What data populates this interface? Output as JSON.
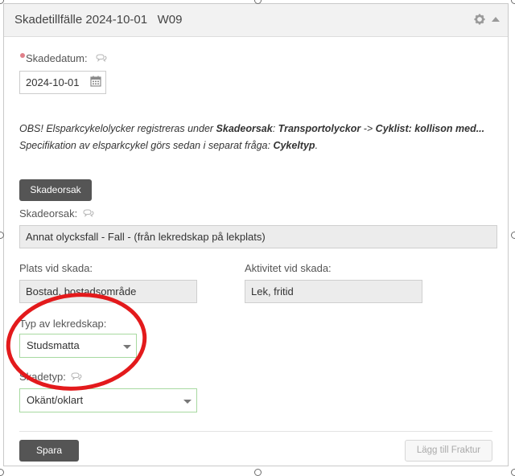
{
  "panel": {
    "title": "Skadetillfälle 2024-10-01   W09"
  },
  "form": {
    "skadedatum": {
      "label": "Skadedatum:",
      "value": "2024-10-01"
    },
    "notice": {
      "line1": {
        "pre": "OBS! Elsparkcykelolycker registreras under ",
        "b1": "Skadeorsak",
        "mid1": ": ",
        "b2": "Transportolyckor",
        "mid2": " -> ",
        "b3": "Cyklist: kollison med..."
      },
      "line2": {
        "pre": "Specifikation av elsparkcykel görs sedan i separat fråga: ",
        "b1": "Cykeltyp",
        "post": "."
      }
    },
    "skadeorsak_button": "Skadeorsak",
    "skadeorsak": {
      "label": "Skadeorsak:",
      "value": "Annat olycksfall - Fall -  (från lekredskap på lekplats)"
    },
    "plats": {
      "label": "Plats vid skada:",
      "value": "Bostad, bostadsområde"
    },
    "aktivitet": {
      "label": "Aktivitet vid skada:",
      "value": "Lek, fritid"
    },
    "lekredskap": {
      "label": "Typ av lekredskap:",
      "value": "Studsmatta"
    },
    "skadetyp": {
      "label": "Skadetyp:",
      "value": "Okänt/oklart"
    }
  },
  "footer": {
    "save_label": "Spara",
    "add_fracture_label": "Lägg till Fraktur"
  },
  "colors": {
    "annotation_circle": "#e31a1c",
    "dark_button": "#555555",
    "select_border": "#a7d9a0",
    "required_dot": "#e0808a"
  }
}
